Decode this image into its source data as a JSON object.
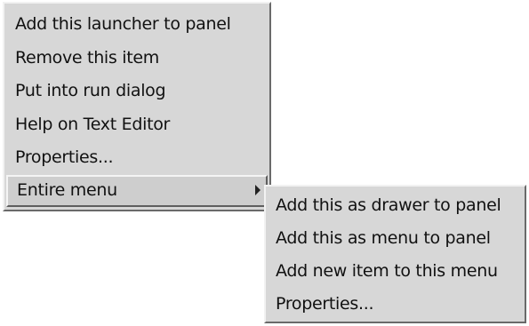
{
  "main_menu": {
    "items": [
      {
        "label": "Add this launcher to panel"
      },
      {
        "label": "Remove this item"
      },
      {
        "label": "Put into run dialog"
      },
      {
        "label": "Help on Text Editor"
      },
      {
        "label": "Properties..."
      },
      {
        "label": "Entire menu",
        "has_submenu": true,
        "highlighted": true
      }
    ]
  },
  "sub_menu": {
    "items": [
      {
        "label": "Add this as drawer to panel"
      },
      {
        "label": "Add this as menu to panel"
      },
      {
        "label": "Add new item to this menu"
      },
      {
        "label": "Properties..."
      }
    ]
  }
}
